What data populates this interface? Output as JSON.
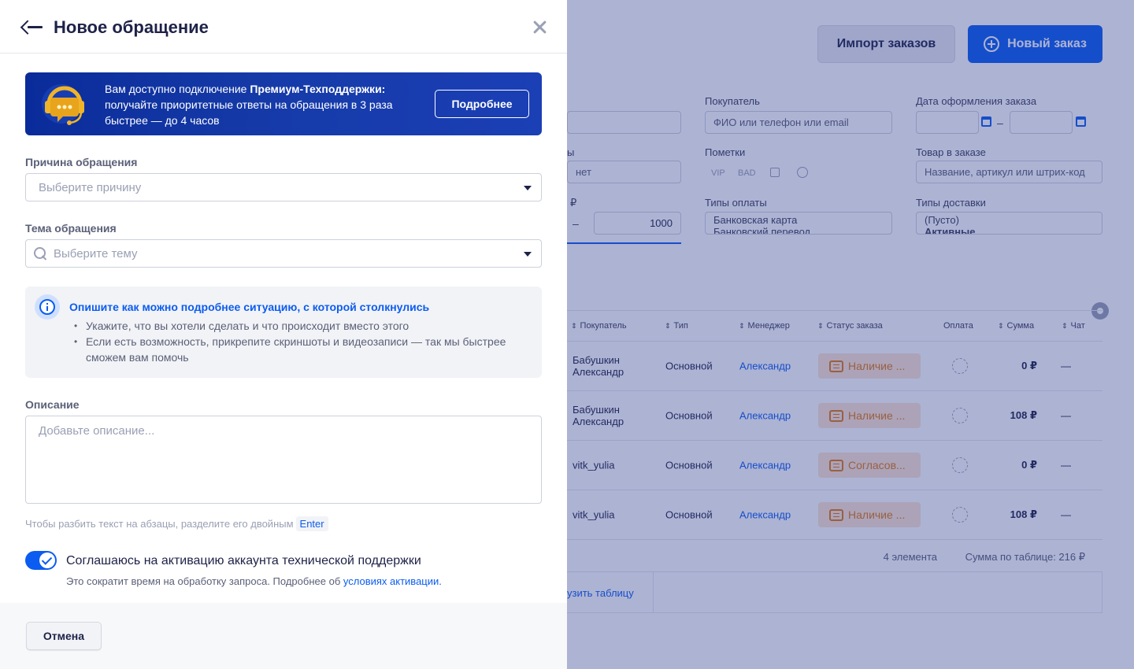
{
  "background": {
    "buttons": {
      "import": "Импорт заказов",
      "new_order": "Новый заказ"
    },
    "filters": {
      "buyer_label": "Покупатель",
      "buyer_placeholder": "ФИО или телефон или email",
      "date_label": "Дата оформления заказа",
      "date_dash": "–",
      "marks_label": "Пометки",
      "marks": [
        "VIP",
        "BAD"
      ],
      "product_label": "Товар в заказе",
      "product_placeholder": "Название, артикул или штрих-код",
      "payment_types_label": "Типы оплаты",
      "payment_types": [
        "Банковская карта",
        "Банковский перевод"
      ],
      "delivery_types_label": "Типы доставки",
      "delivery_types": [
        "(Пусто)",
        "Активные"
      ],
      "partial_label_1": "ы",
      "partial_value_1": "нет",
      "partial_label_2": "₽",
      "range_dash": "–",
      "range_to": "1000"
    },
    "table": {
      "columns": [
        "Покупатель",
        "Тип",
        "Менеджер",
        "Статус заказа",
        "Оплата",
        "Сумма",
        "Чат"
      ],
      "rows": [
        {
          "buyer": "Бабушкин Александр",
          "type": "Основной",
          "manager": "Александр",
          "status": "Наличие ...",
          "sum": "0 ₽",
          "chat": "—"
        },
        {
          "buyer": "Бабушкин Александр",
          "type": "Основной",
          "manager": "Александр",
          "status": "Наличие ...",
          "sum": "108 ₽",
          "chat": "—"
        },
        {
          "buyer": "vitk_yulia",
          "type": "Основной",
          "manager": "Александр",
          "status": "Согласов...",
          "sum": "0 ₽",
          "chat": "—"
        },
        {
          "buyer": "vitk_yulia",
          "type": "Основной",
          "manager": "Александр",
          "status": "Наличие ...",
          "sum": "108 ₽",
          "chat": "—"
        }
      ],
      "count": "4 элемента",
      "total": "Сумма по таблице: 216 ₽",
      "load_link": "узить таблицу"
    }
  },
  "drawer": {
    "title": "Новое обращение",
    "promo": {
      "text_before": "Вам доступно подключение ",
      "text_bold": "Премиум-Техподдержки:",
      "text_after": " получайте приоритетные ответы на обращения в 3 раза быстрее — до 4 часов",
      "button": "Подробнее"
    },
    "reason": {
      "label": "Причина обращения",
      "placeholder": "Выберите причину"
    },
    "topic": {
      "label": "Тема обращения",
      "placeholder": "Выберите тему"
    },
    "info": {
      "title": "Опишите как можно подробнее ситуацию, с которой столкнулись",
      "items": [
        "Укажите, что вы хотели сделать и что происходит вместо этого",
        "Если есть возможность, прикрепите скриншоты и видеозаписи — так мы быстрее сможем вам помочь"
      ]
    },
    "description": {
      "label": "Описание",
      "placeholder": "Добавьте описание...",
      "hint": "Чтобы разбить текст на абзацы, разделите его двойным",
      "hint_key": "Enter"
    },
    "consent": {
      "label": "Соглашаюсь на активацию аккаунта технической поддержки",
      "sub_text": "Это сократит время на обработку запроса. Подробнее об ",
      "sub_link": "условиях активации."
    },
    "cancel": "Отмена"
  },
  "colors": {
    "accent": "#0b5cf0",
    "status_bg": "#fde6d3",
    "status_text": "#e07a14",
    "overlay": "#28388c"
  },
  "icons": [
    "back-arrow-icon",
    "close-icon",
    "headset-icon",
    "search-icon",
    "caret-down-icon",
    "info-icon",
    "check-icon",
    "plus-circle-icon",
    "calendar-icon",
    "settings-icon",
    "chat-icon",
    "clock-icon"
  ]
}
